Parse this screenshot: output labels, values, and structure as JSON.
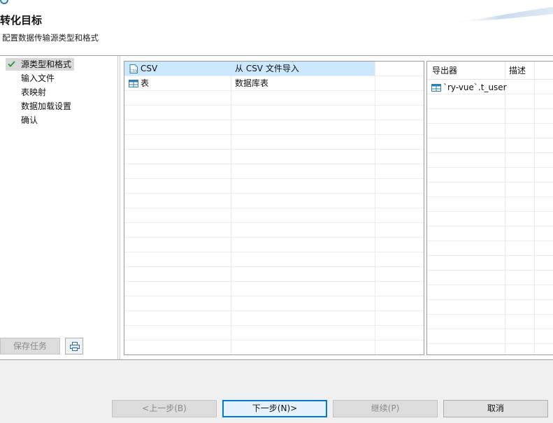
{
  "header": {
    "title": "转化目标",
    "subtitle": "配置数据传输源类型和格式"
  },
  "steps": [
    {
      "label": "源类型和格式",
      "active": true
    },
    {
      "label": "输入文件"
    },
    {
      "label": "表映射"
    },
    {
      "label": "数据加载设置"
    },
    {
      "label": "确认"
    }
  ],
  "left_buttons": {
    "save_task": "保存任务"
  },
  "source_table": {
    "rows": [
      {
        "name": "CSV",
        "description": "从 CSV 文件导入",
        "icon": "csv-file-icon",
        "selected": true
      },
      {
        "name": "表",
        "description": "数据库表",
        "icon": "table-icon"
      }
    ]
  },
  "exporter_table": {
    "columns": [
      "导出器",
      "描述"
    ],
    "rows": [
      {
        "name": "`ry-vue`.t_user",
        "description": "",
        "icon": "table-icon"
      }
    ]
  },
  "footer": {
    "prev": "<上一步(B)",
    "next": "下一步(N)>",
    "continue": "继续(P)",
    "cancel": "取消"
  },
  "colors": {
    "selection": "#cce8ff",
    "primary_border": "#0078d7",
    "check": "#3a9a3a",
    "table_icon": "#2f7fb2"
  }
}
